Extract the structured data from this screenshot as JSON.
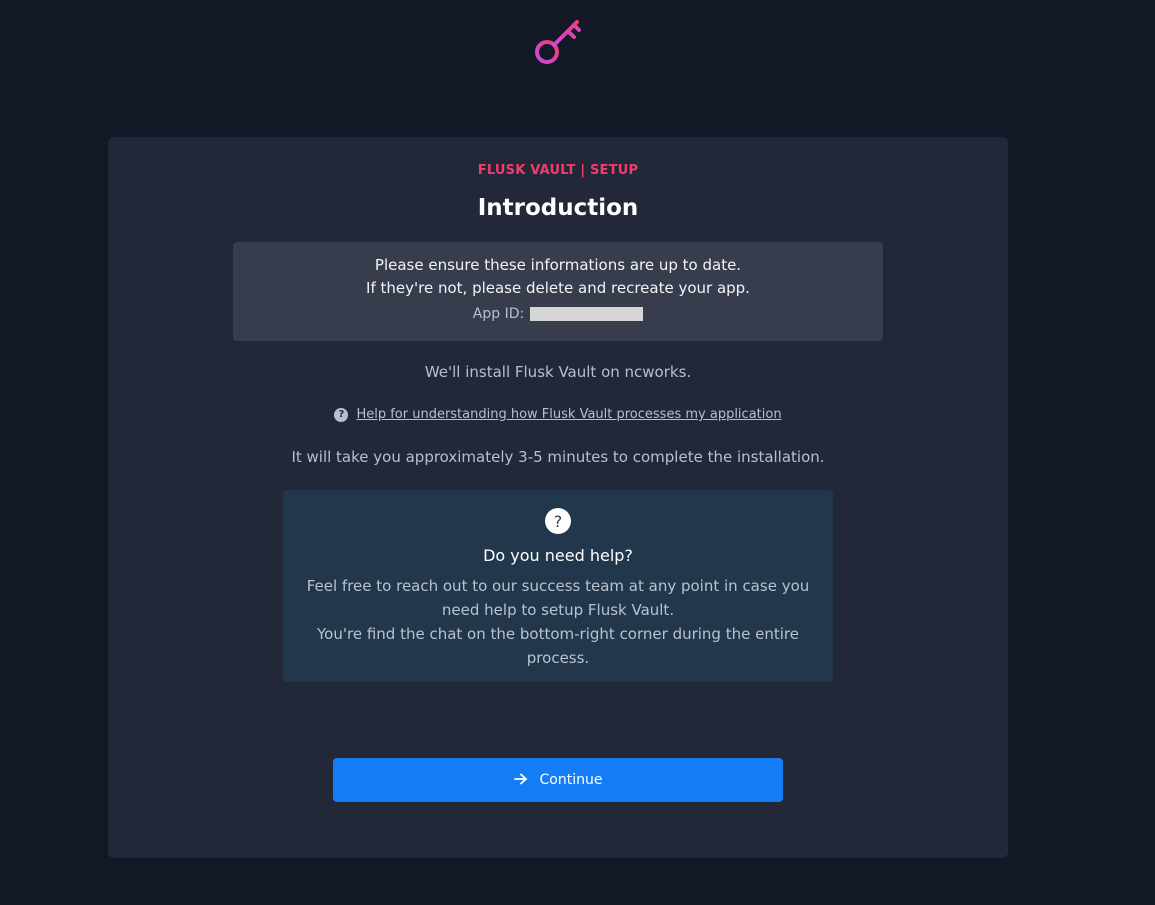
{
  "header": {
    "logo_icon": "key-icon",
    "logo_colors": [
      "#f23c6e",
      "#c94be6"
    ]
  },
  "card": {
    "eyebrow": "FLUSK VAULT | SETUP",
    "title": "Introduction"
  },
  "info_box": {
    "line1": "Please ensure these informations are up to date.",
    "line2": "If they're not, please delete and recreate your app.",
    "app_id_label": "App ID:"
  },
  "install_text": "We'll install Flusk Vault on ncworks.",
  "help_link": {
    "icon": "question-circle-icon",
    "label": "Help for understanding how Flusk Vault processes my application"
  },
  "time_text": "It will take you approximately 3-5 minutes to complete the installation.",
  "help_box": {
    "icon": "question-icon",
    "icon_glyph": "?",
    "title": "Do you need help?",
    "body_line1": "Feel free to reach out to our success team at any point in case you need help to setup Flusk Vault.",
    "body_line2": "You're find the chat on the bottom-right corner during the entire process."
  },
  "continue_button": {
    "icon": "arrow-right-icon",
    "label": "Continue"
  },
  "colors": {
    "background": "#131827",
    "card": "#222838",
    "accent": "#f23c6e",
    "button": "#147df5",
    "help_box": "#22374c"
  }
}
